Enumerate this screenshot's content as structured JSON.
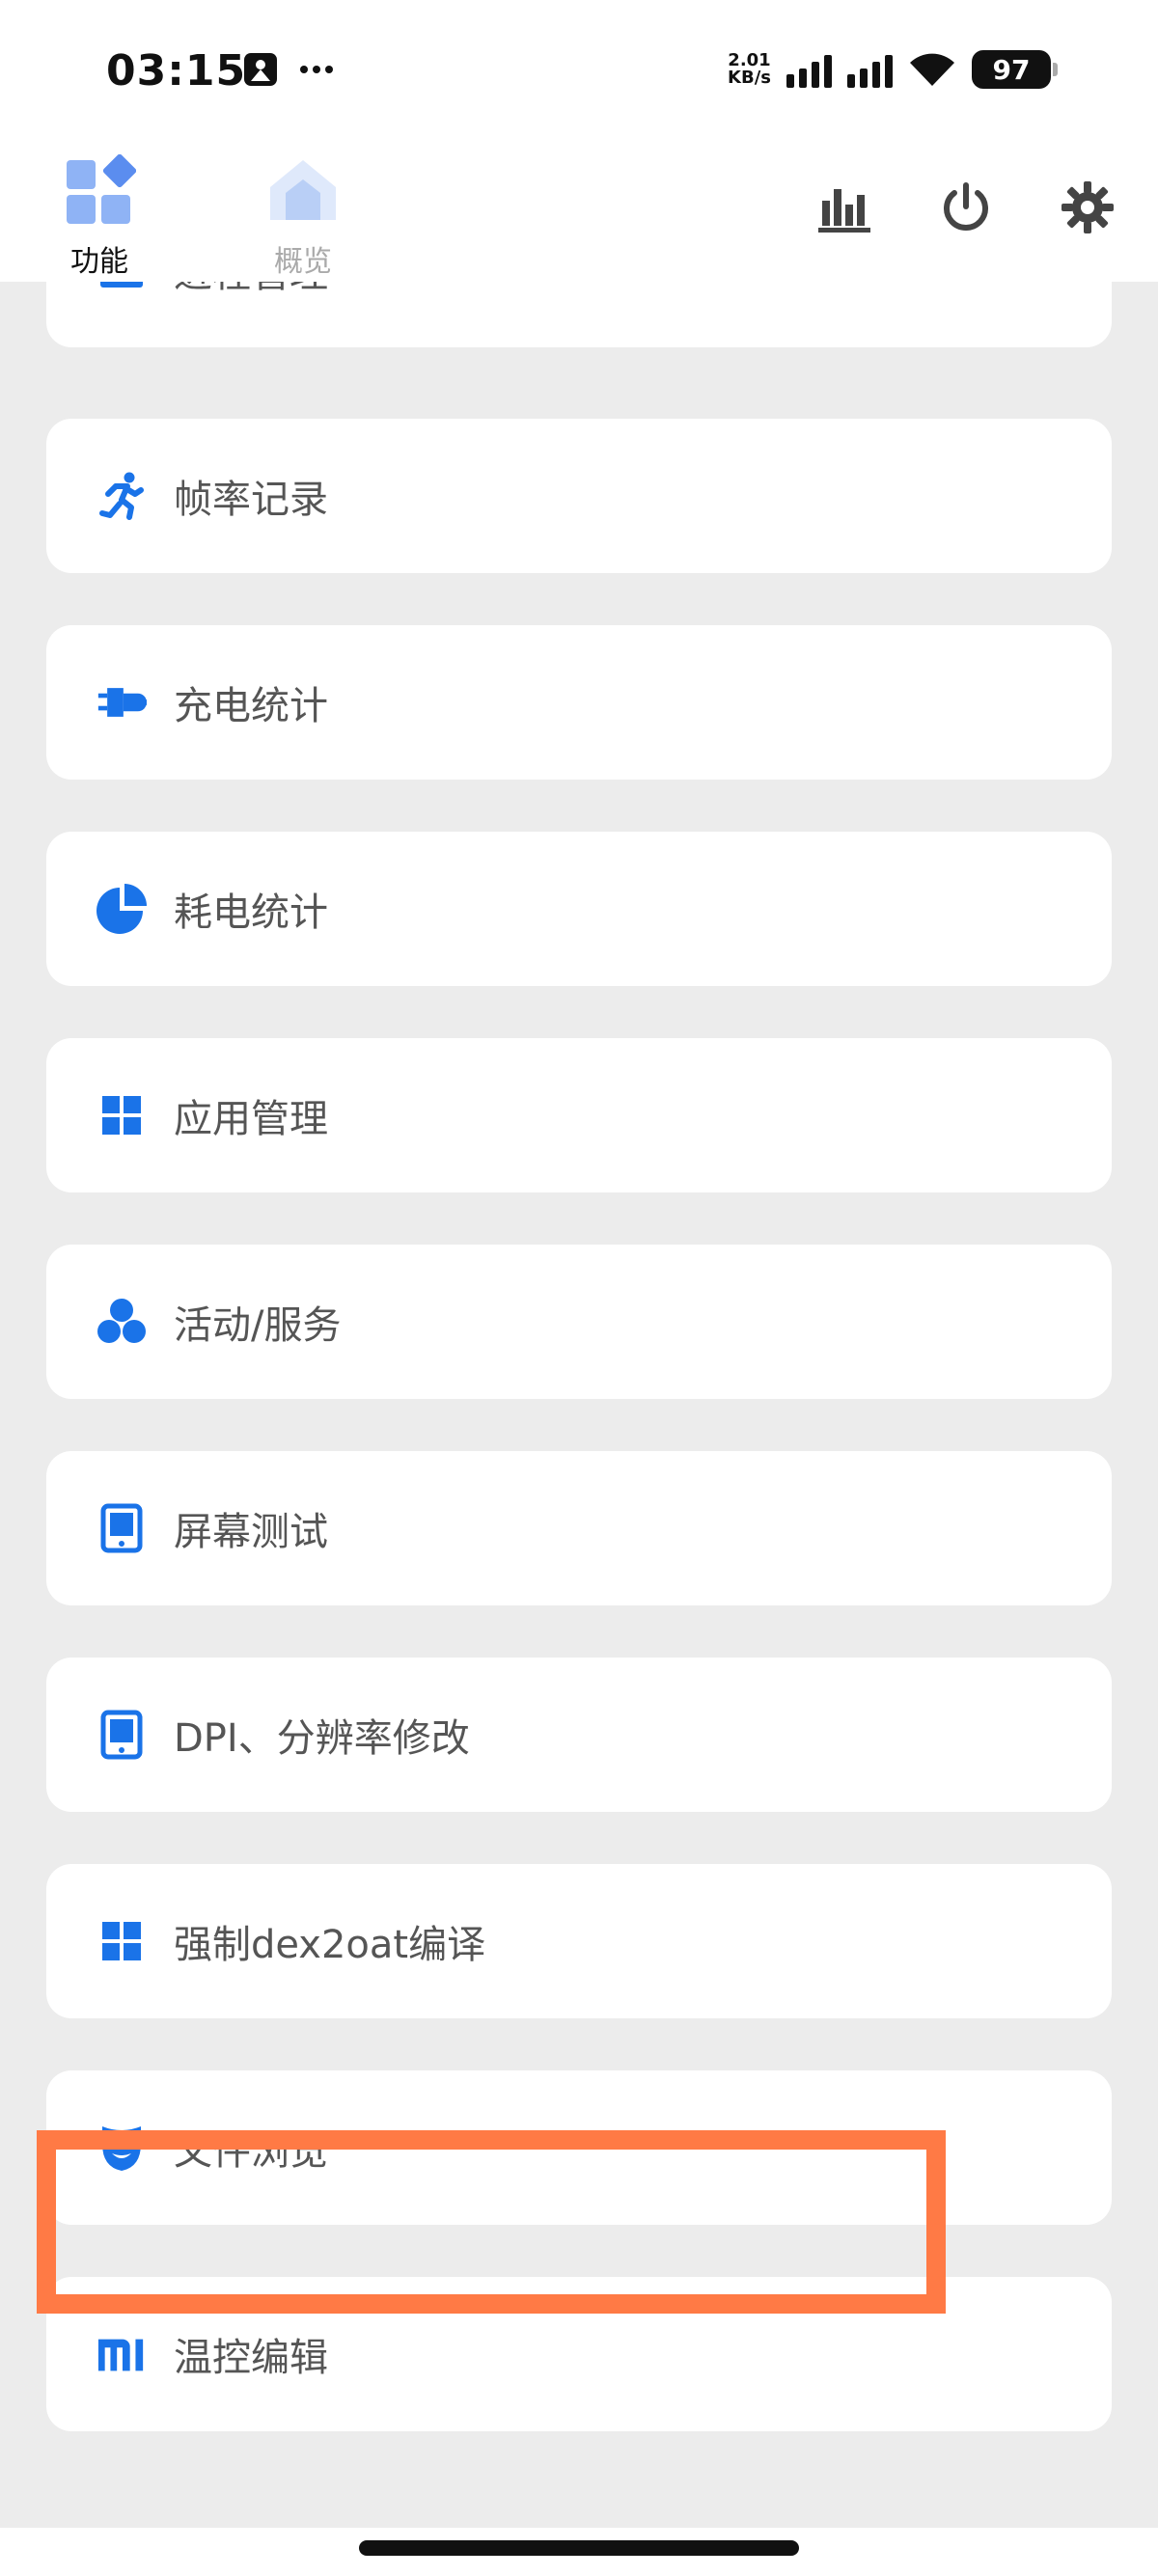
{
  "status": {
    "time": "03:15",
    "net_speed_value": "2.01",
    "net_speed_unit": "KB/s",
    "battery": "97"
  },
  "header": {
    "tabs": [
      {
        "label": "功能",
        "active": true
      },
      {
        "label": "概览",
        "active": false
      }
    ],
    "actions": [
      "bar-chart-icon",
      "power-icon",
      "gear-icon"
    ]
  },
  "menu": {
    "items": [
      {
        "label": "进程管理",
        "icon": "process-icon"
      },
      {
        "label": "帧率记录",
        "icon": "running-person-icon"
      },
      {
        "label": "充电统计",
        "icon": "charger-icon"
      },
      {
        "label": "耗电统计",
        "icon": "pie-chart-icon"
      },
      {
        "label": "应用管理",
        "icon": "apps-grid-icon"
      },
      {
        "label": "活动/服务",
        "icon": "bubbles-icon"
      },
      {
        "label": "屏幕测试",
        "icon": "tablet-icon"
      },
      {
        "label": "DPI、分辨率修改",
        "icon": "tablet-icon"
      },
      {
        "label": "强制dex2oat编译",
        "icon": "apps-grid-icon"
      },
      {
        "label": "文件浏览",
        "icon": "mask-icon"
      },
      {
        "label": "温控编辑",
        "icon": "mi-logo-icon"
      }
    ]
  },
  "colors": {
    "accent": "#1a73e8",
    "highlight": "#ff7a45",
    "background": "#ececec"
  }
}
